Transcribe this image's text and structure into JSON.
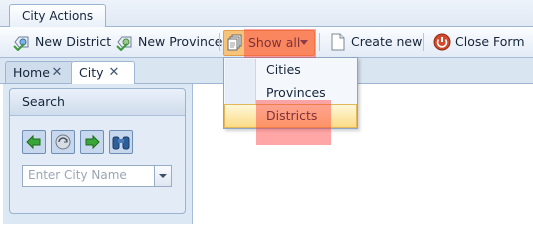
{
  "ribbon": {
    "tab_label": "City Actions"
  },
  "toolbar": {
    "new_district": "New District",
    "new_province": "New Province",
    "show_all": "Show all",
    "create_new": "Create new",
    "close_form": "Close Form"
  },
  "doc_tabs": {
    "home": "Home",
    "city": "City"
  },
  "search": {
    "title": "Search",
    "placeholder": "Enter City Name"
  },
  "show_all_menu": {
    "items": [
      "Cities",
      "Provinces",
      "Districts"
    ],
    "selected": "Districts"
  },
  "colors": {
    "highlight": "#ff3c3c",
    "accent_selected": "#fbdc87"
  }
}
